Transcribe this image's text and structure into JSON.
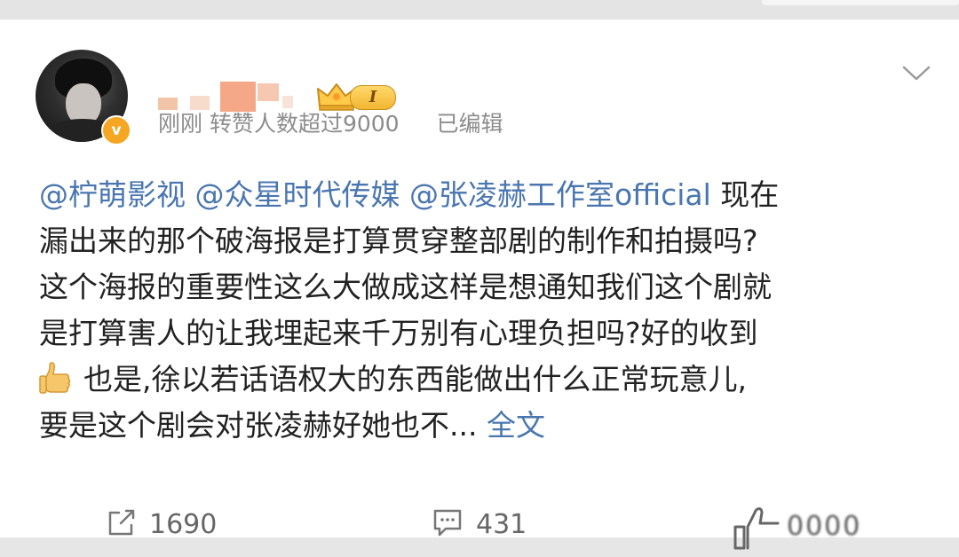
{
  "post": {
    "meta": {
      "time": "刚刚",
      "repost_count_note": "转赞人数超过9000",
      "edited": "已编辑"
    },
    "badge": {
      "level": "I"
    },
    "mentions": [
      "@柠萌影视",
      "@众星时代传媒",
      "@张凌赫工作室official"
    ],
    "lines": [
      "现在",
      "漏出来的那个破海报是打算贯穿整部剧的制作和拍摄吗?",
      "这个海报的重要性这么大做成这样是想通知我们这个剧就",
      "是打算害人的让我埋起来千万别有心理负担吗?好的收到",
      "也是,徐以若话语权大的东西能做出什么正常玩意儿,",
      "要是这个剧会对张凌赫好她也不..."
    ],
    "full_text_link": "全文",
    "emoji": "thumbs-up-icon"
  },
  "footer": {
    "reposts": "1690",
    "comments": "431",
    "likes": "0000"
  },
  "colors": {
    "mention": "#4a76b0",
    "verified": "#f5a623"
  }
}
